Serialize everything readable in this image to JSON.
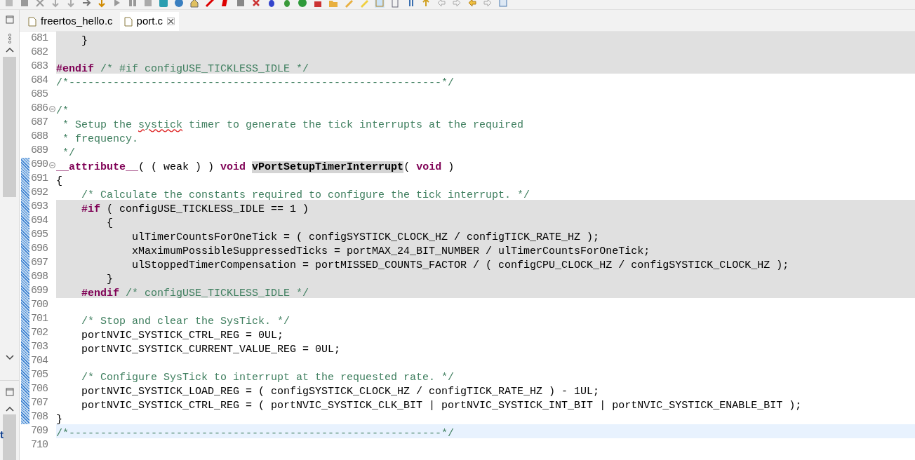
{
  "tabs": [
    {
      "label": "freertos_hello.c",
      "selected": false,
      "closable": false
    },
    {
      "label": "port.c",
      "selected": true,
      "closable": true
    }
  ],
  "trim_fragment": "t",
  "lines": [
    {
      "number": "681",
      "inactive": true,
      "current": false,
      "fold": false,
      "changed": false,
      "tokens": [
        {
          "kind": "plain",
          "text": "    }"
        }
      ]
    },
    {
      "number": "682",
      "inactive": true,
      "current": false,
      "fold": false,
      "changed": false
    },
    {
      "number": "683",
      "inactive": true,
      "current": false,
      "fold": false,
      "changed": false,
      "tokens": [
        {
          "kind": "keyword",
          "text": "#endif"
        },
        {
          "kind": "comment",
          "text": " /* #if configUSE_TICKLESS_IDLE */"
        }
      ]
    },
    {
      "number": "684",
      "inactive": false,
      "current": false,
      "fold": false,
      "changed": false,
      "tokens": [
        {
          "kind": "comment",
          "text": "/*-----------------------------------------------------------*/"
        }
      ]
    },
    {
      "number": "685",
      "inactive": false,
      "current": false,
      "fold": false,
      "changed": false
    },
    {
      "number": "686",
      "inactive": false,
      "current": false,
      "fold": true,
      "changed": false,
      "tokens": [
        {
          "kind": "comment",
          "text": "/*"
        }
      ]
    },
    {
      "number": "687",
      "inactive": false,
      "current": false,
      "fold": false,
      "changed": false,
      "tokens": [
        {
          "kind": "comment",
          "text": " * Setup the "
        },
        {
          "kind": "misspelled",
          "text": "systick"
        },
        {
          "kind": "comment",
          "text": " timer to generate the tick interrupts at the required"
        }
      ]
    },
    {
      "number": "688",
      "inactive": false,
      "current": false,
      "fold": false,
      "changed": false,
      "tokens": [
        {
          "kind": "comment",
          "text": " * frequency."
        }
      ]
    },
    {
      "number": "689",
      "inactive": false,
      "current": false,
      "fold": false,
      "changed": false,
      "tokens": [
        {
          "kind": "comment",
          "text": " */"
        }
      ]
    },
    {
      "number": "690",
      "inactive": false,
      "current": false,
      "fold": true,
      "changed": true,
      "tokens": [
        {
          "kind": "keyword",
          "text": "__attribute__"
        },
        {
          "kind": "plain",
          "text": "( ( weak ) ) "
        },
        {
          "kind": "keyword",
          "text": "void "
        },
        {
          "kind": "occurrence",
          "text": "vPortSetupTimerInterrupt"
        },
        {
          "kind": "plain",
          "text": "( "
        },
        {
          "kind": "keyword",
          "text": "void"
        },
        {
          "kind": "plain",
          "text": " )"
        }
      ]
    },
    {
      "number": "691",
      "inactive": false,
      "current": false,
      "fold": false,
      "changed": true,
      "tokens": [
        {
          "kind": "plain",
          "text": "{"
        }
      ]
    },
    {
      "number": "692",
      "inactive": false,
      "current": false,
      "fold": false,
      "changed": true,
      "tokens": [
        {
          "kind": "comment",
          "text": "    /* Calculate the constants required to configure the tick interrupt. */"
        }
      ]
    },
    {
      "number": "693",
      "inactive": true,
      "current": false,
      "fold": false,
      "changed": true,
      "tokens": [
        {
          "kind": "keyword",
          "text": "    #if"
        },
        {
          "kind": "plain",
          "text": " ( configUSE_TICKLESS_IDLE == 1 )"
        }
      ]
    },
    {
      "number": "694",
      "inactive": true,
      "current": false,
      "fold": false,
      "changed": true,
      "tokens": [
        {
          "kind": "plain",
          "text": "        {"
        }
      ]
    },
    {
      "number": "695",
      "inactive": true,
      "current": false,
      "fold": false,
      "changed": true,
      "tokens": [
        {
          "kind": "plain",
          "text": "            ulTimerCountsForOneTick = ( configSYSTICK_CLOCK_HZ / configTICK_RATE_HZ );"
        }
      ]
    },
    {
      "number": "696",
      "inactive": true,
      "current": false,
      "fold": false,
      "changed": true,
      "tokens": [
        {
          "kind": "plain",
          "text": "            xMaximumPossibleSuppressedTicks = portMAX_24_BIT_NUMBER / ulTimerCountsForOneTick;"
        }
      ]
    },
    {
      "number": "697",
      "inactive": true,
      "current": false,
      "fold": false,
      "changed": true,
      "tokens": [
        {
          "kind": "plain",
          "text": "            ulStoppedTimerCompensation = portMISSED_COUNTS_FACTOR / ( configCPU_CLOCK_HZ / configSYSTICK_CLOCK_HZ );"
        }
      ]
    },
    {
      "number": "698",
      "inactive": true,
      "current": false,
      "fold": false,
      "changed": true,
      "tokens": [
        {
          "kind": "plain",
          "text": "        }"
        }
      ]
    },
    {
      "number": "699",
      "inactive": true,
      "current": false,
      "fold": false,
      "changed": true,
      "tokens": [
        {
          "kind": "keyword",
          "text": "    #endif"
        },
        {
          "kind": "comment",
          "text": " /* configUSE_TICKLESS_IDLE */"
        }
      ]
    },
    {
      "number": "700",
      "inactive": false,
      "current": false,
      "fold": false,
      "changed": true
    },
    {
      "number": "701",
      "inactive": false,
      "current": false,
      "fold": false,
      "changed": true,
      "tokens": [
        {
          "kind": "comment",
          "text": "    /* Stop and clear the SysTick. */"
        }
      ]
    },
    {
      "number": "702",
      "inactive": false,
      "current": false,
      "fold": false,
      "changed": true,
      "tokens": [
        {
          "kind": "plain",
          "text": "    portNVIC_SYSTICK_CTRL_REG = 0UL;"
        }
      ]
    },
    {
      "number": "703",
      "inactive": false,
      "current": false,
      "fold": false,
      "changed": true,
      "tokens": [
        {
          "kind": "plain",
          "text": "    portNVIC_SYSTICK_CURRENT_VALUE_REG = 0UL;"
        }
      ]
    },
    {
      "number": "704",
      "inactive": false,
      "current": false,
      "fold": false,
      "changed": true
    },
    {
      "number": "705",
      "inactive": false,
      "current": false,
      "fold": false,
      "changed": true,
      "tokens": [
        {
          "kind": "comment",
          "text": "    /* Configure SysTick to interrupt at the requested rate. */"
        }
      ]
    },
    {
      "number": "706",
      "inactive": false,
      "current": false,
      "fold": false,
      "changed": true,
      "tokens": [
        {
          "kind": "plain",
          "text": "    portNVIC_SYSTICK_LOAD_REG = ( configSYSTICK_CLOCK_HZ / configTICK_RATE_HZ ) - 1UL;"
        }
      ]
    },
    {
      "number": "707",
      "inactive": false,
      "current": false,
      "fold": false,
      "changed": true,
      "tokens": [
        {
          "kind": "plain",
          "text": "    portNVIC_SYSTICK_CTRL_REG = ( portNVIC_SYSTICK_CLK_BIT | portNVIC_SYSTICK_INT_BIT | portNVIC_SYSTICK_ENABLE_BIT );"
        }
      ]
    },
    {
      "number": "708",
      "inactive": false,
      "current": false,
      "fold": false,
      "changed": true,
      "tokens": [
        {
          "kind": "plain",
          "text": "}"
        }
      ]
    },
    {
      "number": "709",
      "inactive": false,
      "current": true,
      "fold": false,
      "changed": false,
      "tokens": [
        {
          "kind": "comment",
          "text": "/*-----------------------------------------------------------*/"
        }
      ]
    },
    {
      "number": "710",
      "inactive": false,
      "current": false,
      "fold": false,
      "changed": false
    }
  ]
}
